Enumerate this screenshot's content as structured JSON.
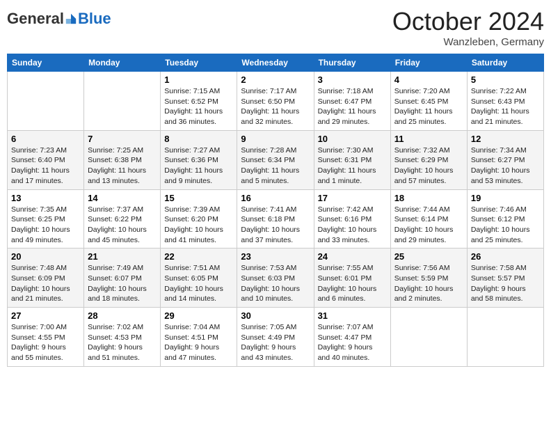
{
  "header": {
    "logo_general": "General",
    "logo_blue": "Blue",
    "month": "October 2024",
    "location": "Wanzleben, Germany"
  },
  "days_of_week": [
    "Sunday",
    "Monday",
    "Tuesday",
    "Wednesday",
    "Thursday",
    "Friday",
    "Saturday"
  ],
  "weeks": [
    [
      {
        "day": "",
        "info": ""
      },
      {
        "day": "",
        "info": ""
      },
      {
        "day": "1",
        "info": "Sunrise: 7:15 AM\nSunset: 6:52 PM\nDaylight: 11 hours\nand 36 minutes."
      },
      {
        "day": "2",
        "info": "Sunrise: 7:17 AM\nSunset: 6:50 PM\nDaylight: 11 hours\nand 32 minutes."
      },
      {
        "day": "3",
        "info": "Sunrise: 7:18 AM\nSunset: 6:47 PM\nDaylight: 11 hours\nand 29 minutes."
      },
      {
        "day": "4",
        "info": "Sunrise: 7:20 AM\nSunset: 6:45 PM\nDaylight: 11 hours\nand 25 minutes."
      },
      {
        "day": "5",
        "info": "Sunrise: 7:22 AM\nSunset: 6:43 PM\nDaylight: 11 hours\nand 21 minutes."
      }
    ],
    [
      {
        "day": "6",
        "info": "Sunrise: 7:23 AM\nSunset: 6:40 PM\nDaylight: 11 hours\nand 17 minutes."
      },
      {
        "day": "7",
        "info": "Sunrise: 7:25 AM\nSunset: 6:38 PM\nDaylight: 11 hours\nand 13 minutes."
      },
      {
        "day": "8",
        "info": "Sunrise: 7:27 AM\nSunset: 6:36 PM\nDaylight: 11 hours\nand 9 minutes."
      },
      {
        "day": "9",
        "info": "Sunrise: 7:28 AM\nSunset: 6:34 PM\nDaylight: 11 hours\nand 5 minutes."
      },
      {
        "day": "10",
        "info": "Sunrise: 7:30 AM\nSunset: 6:31 PM\nDaylight: 11 hours\nand 1 minute."
      },
      {
        "day": "11",
        "info": "Sunrise: 7:32 AM\nSunset: 6:29 PM\nDaylight: 10 hours\nand 57 minutes."
      },
      {
        "day": "12",
        "info": "Sunrise: 7:34 AM\nSunset: 6:27 PM\nDaylight: 10 hours\nand 53 minutes."
      }
    ],
    [
      {
        "day": "13",
        "info": "Sunrise: 7:35 AM\nSunset: 6:25 PM\nDaylight: 10 hours\nand 49 minutes."
      },
      {
        "day": "14",
        "info": "Sunrise: 7:37 AM\nSunset: 6:22 PM\nDaylight: 10 hours\nand 45 minutes."
      },
      {
        "day": "15",
        "info": "Sunrise: 7:39 AM\nSunset: 6:20 PM\nDaylight: 10 hours\nand 41 minutes."
      },
      {
        "day": "16",
        "info": "Sunrise: 7:41 AM\nSunset: 6:18 PM\nDaylight: 10 hours\nand 37 minutes."
      },
      {
        "day": "17",
        "info": "Sunrise: 7:42 AM\nSunset: 6:16 PM\nDaylight: 10 hours\nand 33 minutes."
      },
      {
        "day": "18",
        "info": "Sunrise: 7:44 AM\nSunset: 6:14 PM\nDaylight: 10 hours\nand 29 minutes."
      },
      {
        "day": "19",
        "info": "Sunrise: 7:46 AM\nSunset: 6:12 PM\nDaylight: 10 hours\nand 25 minutes."
      }
    ],
    [
      {
        "day": "20",
        "info": "Sunrise: 7:48 AM\nSunset: 6:09 PM\nDaylight: 10 hours\nand 21 minutes."
      },
      {
        "day": "21",
        "info": "Sunrise: 7:49 AM\nSunset: 6:07 PM\nDaylight: 10 hours\nand 18 minutes."
      },
      {
        "day": "22",
        "info": "Sunrise: 7:51 AM\nSunset: 6:05 PM\nDaylight: 10 hours\nand 14 minutes."
      },
      {
        "day": "23",
        "info": "Sunrise: 7:53 AM\nSunset: 6:03 PM\nDaylight: 10 hours\nand 10 minutes."
      },
      {
        "day": "24",
        "info": "Sunrise: 7:55 AM\nSunset: 6:01 PM\nDaylight: 10 hours\nand 6 minutes."
      },
      {
        "day": "25",
        "info": "Sunrise: 7:56 AM\nSunset: 5:59 PM\nDaylight: 10 hours\nand 2 minutes."
      },
      {
        "day": "26",
        "info": "Sunrise: 7:58 AM\nSunset: 5:57 PM\nDaylight: 9 hours\nand 58 minutes."
      }
    ],
    [
      {
        "day": "27",
        "info": "Sunrise: 7:00 AM\nSunset: 4:55 PM\nDaylight: 9 hours\nand 55 minutes."
      },
      {
        "day": "28",
        "info": "Sunrise: 7:02 AM\nSunset: 4:53 PM\nDaylight: 9 hours\nand 51 minutes."
      },
      {
        "day": "29",
        "info": "Sunrise: 7:04 AM\nSunset: 4:51 PM\nDaylight: 9 hours\nand 47 minutes."
      },
      {
        "day": "30",
        "info": "Sunrise: 7:05 AM\nSunset: 4:49 PM\nDaylight: 9 hours\nand 43 minutes."
      },
      {
        "day": "31",
        "info": "Sunrise: 7:07 AM\nSunset: 4:47 PM\nDaylight: 9 hours\nand 40 minutes."
      },
      {
        "day": "",
        "info": ""
      },
      {
        "day": "",
        "info": ""
      }
    ]
  ]
}
